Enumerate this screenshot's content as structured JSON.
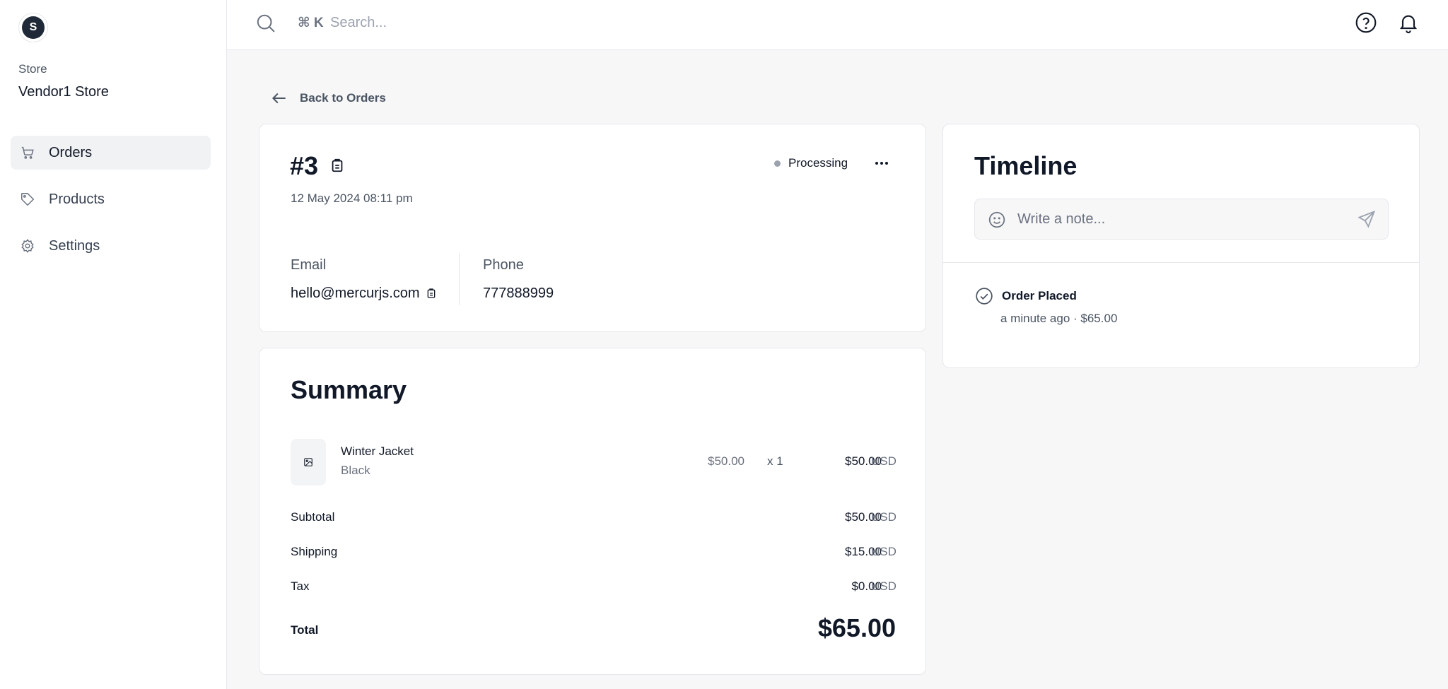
{
  "sidebar": {
    "avatar_initial": "S",
    "store_label": "Store",
    "store_name": "Vendor1 Store",
    "items": [
      {
        "label": "Orders",
        "icon": "cart-icon",
        "active": true
      },
      {
        "label": "Products",
        "icon": "tag-icon",
        "active": false
      },
      {
        "label": "Settings",
        "icon": "gear-icon",
        "active": false
      }
    ]
  },
  "topbar": {
    "shortcut": "⌘ K",
    "search_placeholder": "Search..."
  },
  "back_link": "Back to Orders",
  "order": {
    "id": "#3",
    "date": "12 May 2024 08:11 pm",
    "status": "Processing",
    "email_label": "Email",
    "email": "hello@mercurjs.com",
    "phone_label": "Phone",
    "phone": "777888999"
  },
  "summary": {
    "title": "Summary",
    "items": [
      {
        "name": "Winter Jacket",
        "variant": "Black",
        "unit_price": "$50.00",
        "quantity": "x 1",
        "total": "$50.00",
        "currency": "USD"
      }
    ],
    "subtotal_label": "Subtotal",
    "subtotal": "$50.00",
    "shipping_label": "Shipping",
    "shipping": "$15.00",
    "tax_label": "Tax",
    "tax": "$0.00",
    "currency": "USD",
    "total_label": "Total",
    "total": "$65.00"
  },
  "timeline": {
    "title": "Timeline",
    "note_placeholder": "Write a note...",
    "events": [
      {
        "title": "Order Placed",
        "meta": "a minute ago · $65.00"
      }
    ]
  },
  "colors": {
    "background": "#f7f7f8",
    "card": "#ffffff",
    "border": "#e5e7eb",
    "text": "#111827",
    "muted": "#6b7280",
    "status_dot": "#9ca3af"
  }
}
